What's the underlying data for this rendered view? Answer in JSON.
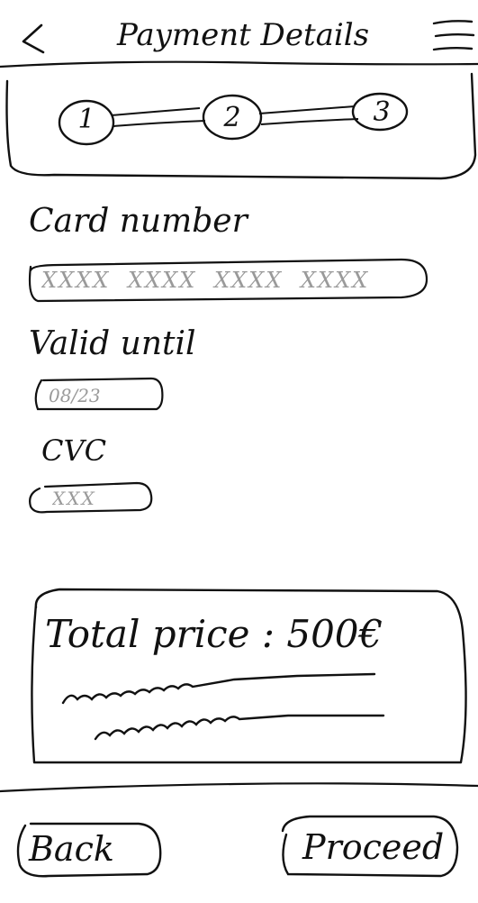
{
  "header": {
    "title": "Payment Details",
    "back_icon": "chevron-left-icon",
    "menu_icon": "hamburger-menu-icon"
  },
  "stepper": {
    "steps": [
      "1",
      "2",
      "3"
    ],
    "current_step": 2
  },
  "form": {
    "card_number": {
      "label": "Card number",
      "placeholder": "XXXX XXXX XXXX XXXX",
      "value": ""
    },
    "valid_until": {
      "label": "Valid until",
      "placeholder": "08/23",
      "value": ""
    },
    "cvc": {
      "label": "CVC",
      "placeholder": "XXX",
      "value": ""
    }
  },
  "summary": {
    "total_label": "Total price : 500€"
  },
  "footer": {
    "back_label": "Back",
    "proceed_label": "Proceed"
  },
  "colors": {
    "ink": "#111111",
    "placeholder": "#9a9a9a",
    "background": "#ffffff"
  }
}
